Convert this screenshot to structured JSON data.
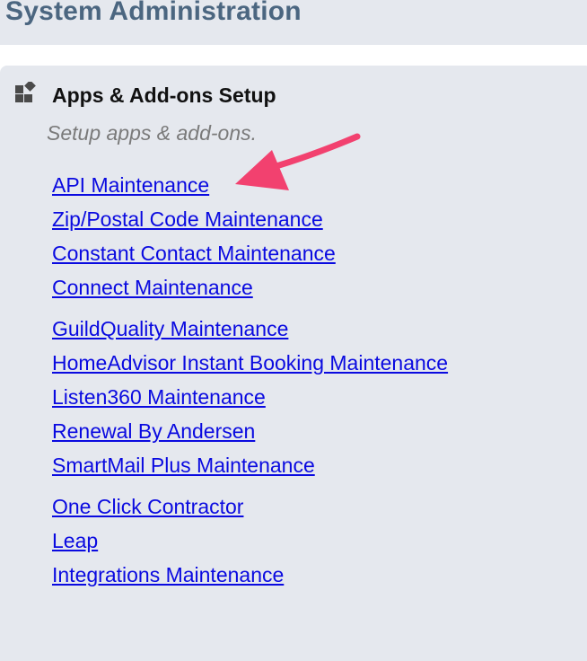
{
  "header": {
    "title": "System Administration"
  },
  "section": {
    "icon": "apps-addons-icon",
    "title": "Apps & Add-ons Setup",
    "description": "Setup apps & add-ons."
  },
  "links": [
    {
      "label": "API Maintenance"
    },
    {
      "label": "Zip/Postal Code Maintenance"
    },
    {
      "label": "Constant Contact Maintenance"
    },
    {
      "label": "Connect Maintenance"
    },
    {
      "label": "GuildQuality Maintenance"
    },
    {
      "label": "HomeAdvisor Instant Booking Maintenance"
    },
    {
      "label": "Listen360 Maintenance"
    },
    {
      "label": "Renewal By Andersen"
    },
    {
      "label": "SmartMail Plus Maintenance"
    },
    {
      "label": "One Click Contractor"
    },
    {
      "label": "Leap"
    },
    {
      "label": "Integrations Maintenance"
    }
  ],
  "colors": {
    "title": "#4b6680",
    "panel": "#e5e8ee",
    "link": "#0a0ae0",
    "annotation_arrow": "#f2416f"
  }
}
